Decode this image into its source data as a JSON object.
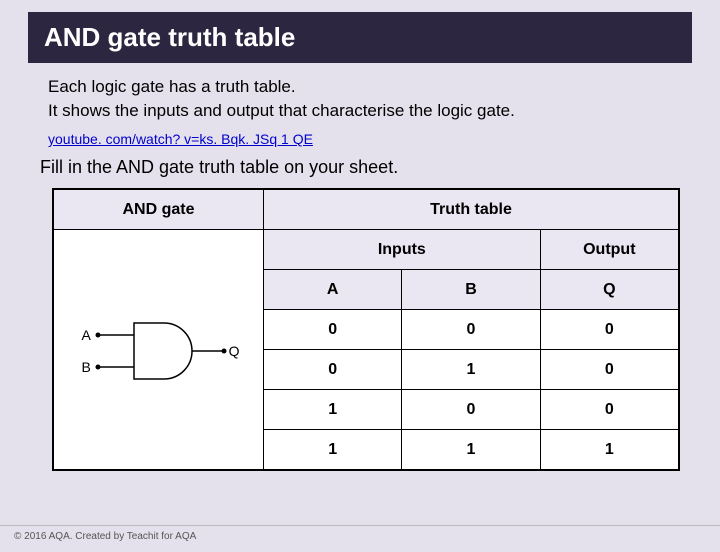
{
  "title": "AND gate truth table",
  "intro": {
    "line1": "Each logic gate has a truth table.",
    "line2": "It shows the inputs and output that characterise the logic gate."
  },
  "link_text": "youtube. com/watch? v=ks. Bqk. JSq 1 QE",
  "instruction": "Fill in the AND gate truth table on your sheet.",
  "table": {
    "gate_header": "AND gate",
    "truth_header": "Truth table",
    "inputs_header": "Inputs",
    "output_header": "Output",
    "cols": {
      "a": "A",
      "b": "B",
      "q": "Q"
    },
    "rows": [
      {
        "a": "0",
        "b": "0",
        "q": "0"
      },
      {
        "a": "0",
        "b": "1",
        "q": "0"
      },
      {
        "a": "1",
        "b": "0",
        "q": "0"
      },
      {
        "a": "1",
        "b": "1",
        "q": "1"
      }
    ]
  },
  "gate_labels": {
    "a": "A",
    "b": "B",
    "q": "Q"
  },
  "footer": "© 2016 AQA. Created by Teachit for AQA",
  "chart_data": {
    "type": "table",
    "title": "AND gate truth table",
    "columns": [
      "A",
      "B",
      "Q"
    ],
    "rows": [
      [
        0,
        0,
        0
      ],
      [
        0,
        1,
        0
      ],
      [
        1,
        0,
        0
      ],
      [
        1,
        1,
        1
      ]
    ]
  }
}
